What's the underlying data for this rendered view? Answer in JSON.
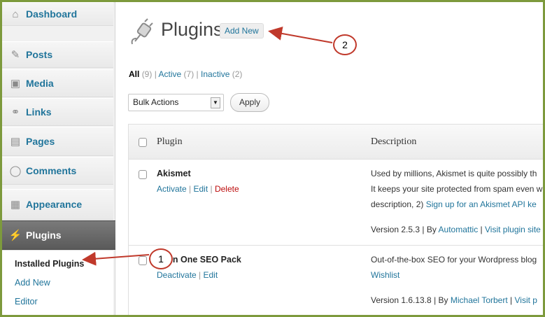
{
  "sidebar": {
    "items": [
      {
        "icon": "house-icon",
        "label": "Dashboard"
      },
      {
        "icon": "pushpin-icon",
        "label": "Posts"
      },
      {
        "icon": "media-icon",
        "label": "Media"
      },
      {
        "icon": "link-icon",
        "label": "Links"
      },
      {
        "icon": "pages-icon",
        "label": "Pages"
      },
      {
        "icon": "comment-bubble-icon",
        "label": "Comments"
      },
      {
        "icon": "appearance-icon",
        "label": "Appearance"
      },
      {
        "icon": "plug-icon",
        "label": "Plugins"
      }
    ],
    "submenu": [
      "Installed Plugins",
      "Add New",
      "Editor"
    ]
  },
  "header": {
    "title": "Plugins",
    "add_new": "Add New"
  },
  "filters": {
    "all": "All",
    "all_count": "(9)",
    "active": "Active",
    "active_count": "(7)",
    "inactive": "Inactive",
    "inactive_count": "(2)",
    "sep": "|"
  },
  "bulk": {
    "selected": "Bulk Actions",
    "apply": "Apply"
  },
  "table": {
    "headers": {
      "plugin": "Plugin",
      "description": "Description"
    },
    "rows": [
      {
        "name": "Akismet",
        "actions": [
          "Activate",
          "Edit",
          "Delete"
        ],
        "desc_line1": "Used by millions, Akismet is quite possibly th",
        "desc_line2": "It keeps your site protected from spam even w",
        "desc_line3_pre": "description, 2)",
        "desc_line3_link": "Sign up for an Akismet API ke",
        "version": "Version 2.5.3 | By",
        "author": "Automattic",
        "visit": "Visit plugin site"
      },
      {
        "name": "All in One SEO Pack",
        "actions": [
          "Deactivate",
          "Edit"
        ],
        "desc_line1": "Out-of-the-box SEO for your Wordpress blog",
        "desc_link": "Wishlist",
        "version": "Version 1.6.13.8 | By",
        "author": "Michael Torbert",
        "visit": "Visit p"
      }
    ]
  },
  "callouts": {
    "one": "1",
    "two": "2"
  },
  "colors": {
    "accent": "#21759b",
    "frame": "#7d9a3c",
    "callout": "#c0392b",
    "delete": "#bc0b0b"
  }
}
